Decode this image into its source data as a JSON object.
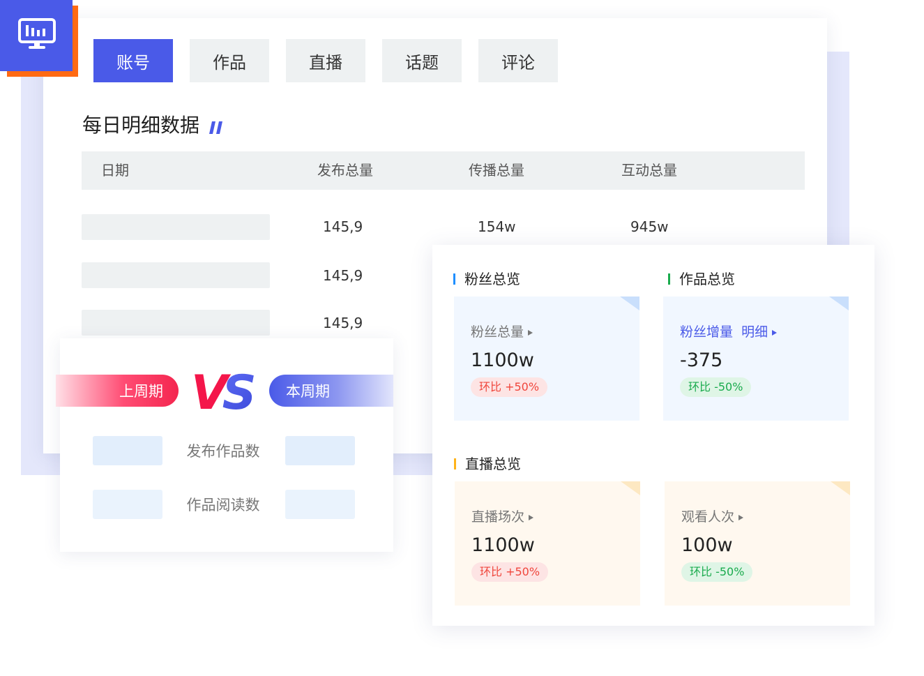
{
  "tabs": [
    {
      "label": "账号",
      "active": true
    },
    {
      "label": "作品",
      "active": false
    },
    {
      "label": "直播",
      "active": false
    },
    {
      "label": "话题",
      "active": false
    },
    {
      "label": "评论",
      "active": false
    }
  ],
  "daily": {
    "title": "每日明细数据",
    "columns": [
      "日期",
      "发布总量",
      "传播总量",
      "互动总量"
    ],
    "rows": [
      {
        "publish": "145,9",
        "spread": "154w",
        "interact": "945w"
      },
      {
        "publish": "145,9"
      },
      {
        "publish": "145,9"
      }
    ]
  },
  "compare": {
    "left_label": "上周期",
    "right_label": "本周期",
    "vs": "VS",
    "metrics": [
      "发布作品数",
      "作品阅读数"
    ]
  },
  "fans_overview": {
    "title": "粉丝总览",
    "tile": {
      "label": "粉丝总量",
      "value": "1100w",
      "change": "环比 +50%"
    }
  },
  "works_overview": {
    "title": "作品总览",
    "tile": {
      "label": "粉丝增量",
      "link": "明细",
      "value": "-375",
      "change": "环比 -50%"
    }
  },
  "live_overview": {
    "title": "直播总览",
    "tiles": [
      {
        "label": "直播场次",
        "value": "1100w",
        "change": "环比 +50%"
      },
      {
        "label": "观看人次",
        "value": "100w",
        "change": "环比 -50%"
      }
    ]
  },
  "colors": {
    "accent": "#4a5ae8",
    "logo_back": "#ff6a13",
    "bar_blue": "#1f8fff",
    "bar_green": "#1aab4d",
    "bar_orange": "#ffb31a",
    "up_red": "#f0463c",
    "down_green": "#1aab4d"
  },
  "icons": {
    "logo": "monitor-chart-icon",
    "title_deco": "double-slash-icon",
    "arrow": "triangle-right-icon"
  }
}
